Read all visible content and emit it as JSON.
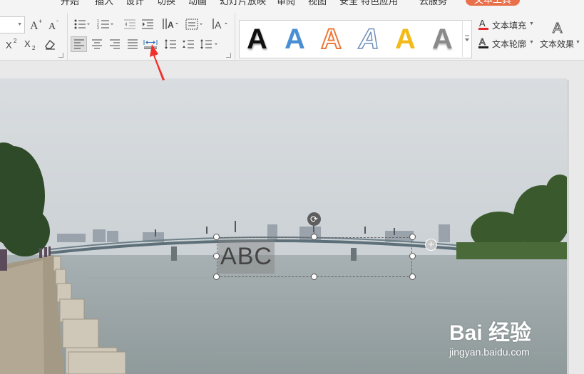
{
  "tabs": [
    {
      "label": "开始",
      "active": false
    },
    {
      "label": "插入",
      "active": false
    },
    {
      "label": "设计",
      "active": false
    },
    {
      "label": "切换",
      "active": false
    },
    {
      "label": "动画",
      "active": false
    },
    {
      "label": "幻灯片放映",
      "active": false
    },
    {
      "label": "审阅",
      "active": false
    },
    {
      "label": "视图",
      "active": false
    },
    {
      "label": "安全",
      "active": false
    },
    {
      "label": "特色应用",
      "active": false
    },
    {
      "label": "云服务",
      "active": false
    },
    {
      "label": "文本工具",
      "active": true
    }
  ],
  "ribbon": {
    "wordart_gallery": [
      "A",
      "A",
      "A",
      "A",
      "A",
      "A"
    ],
    "text_fill_label": "文本填充",
    "text_outline_label": "文本轮廓",
    "text_effects_label": "文本效果",
    "accent_color": "#e8704a",
    "arrow_color": "#f0302a"
  },
  "textbox": {
    "text": "ABC"
  },
  "watermark": {
    "brand": "Bai 经验",
    "url": "jingyan.baidu.com"
  }
}
